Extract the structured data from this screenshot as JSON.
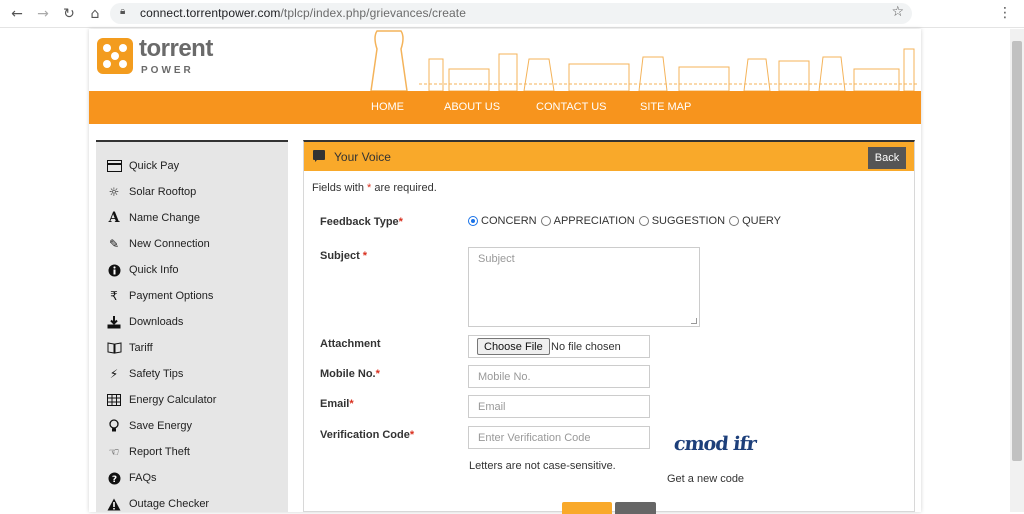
{
  "browser": {
    "url_domain": "connect.torrentpower.com",
    "url_path": "/tplcp/index.php/grievances/create"
  },
  "site": {
    "logo_name": "torrent",
    "logo_sub": "POWER",
    "nav": [
      "HOME",
      "ABOUT US",
      "CONTACT US",
      "SITE MAP"
    ],
    "accent_color": "#f7941d"
  },
  "sidebar": {
    "items": [
      {
        "label": "Quick Pay",
        "icon": "card-icon"
      },
      {
        "label": "Solar Rooftop",
        "icon": "sun-icon"
      },
      {
        "label": "Name Change",
        "icon": "font-icon"
      },
      {
        "label": "New Connection",
        "icon": "pencil-icon"
      },
      {
        "label": "Quick Info",
        "icon": "info-icon"
      },
      {
        "label": "Payment Options",
        "icon": "rupee-icon"
      },
      {
        "label": "Downloads",
        "icon": "download-icon"
      },
      {
        "label": "Tariff",
        "icon": "book-icon"
      },
      {
        "label": "Safety Tips",
        "icon": "wand-icon"
      },
      {
        "label": "Energy Calculator",
        "icon": "table-icon"
      },
      {
        "label": "Save Energy",
        "icon": "bulb-icon"
      },
      {
        "label": "Report Theft",
        "icon": "hand-icon"
      },
      {
        "label": "FAQs",
        "icon": "question-icon"
      },
      {
        "label": "Outage Checker",
        "icon": "warning-icon"
      }
    ]
  },
  "form": {
    "panel_title": "Your Voice",
    "back_label": "Back",
    "required_prefix": "Fields with",
    "required_star": "*",
    "required_suffix": "are required.",
    "labels": {
      "feedback_type": "Feedback Type",
      "subject": "Subject",
      "attachment": "Attachment",
      "mobile": "Mobile No.",
      "email": "Email",
      "verification": "Verification Code"
    },
    "feedback_options": [
      {
        "label": "CONCERN",
        "selected": true
      },
      {
        "label": "APPRECIATION",
        "selected": false
      },
      {
        "label": "SUGGESTION",
        "selected": false
      },
      {
        "label": "QUERY",
        "selected": false
      }
    ],
    "placeholders": {
      "subject": "Subject",
      "mobile": "Mobile No.",
      "email": "Email",
      "verification": "Enter Verification Code"
    },
    "file": {
      "button": "Choose File",
      "status": "No file chosen"
    },
    "captcha_text": "cmod ifr",
    "case_note": "Letters are not case-sensitive.",
    "new_code_link": "Get a new code"
  }
}
